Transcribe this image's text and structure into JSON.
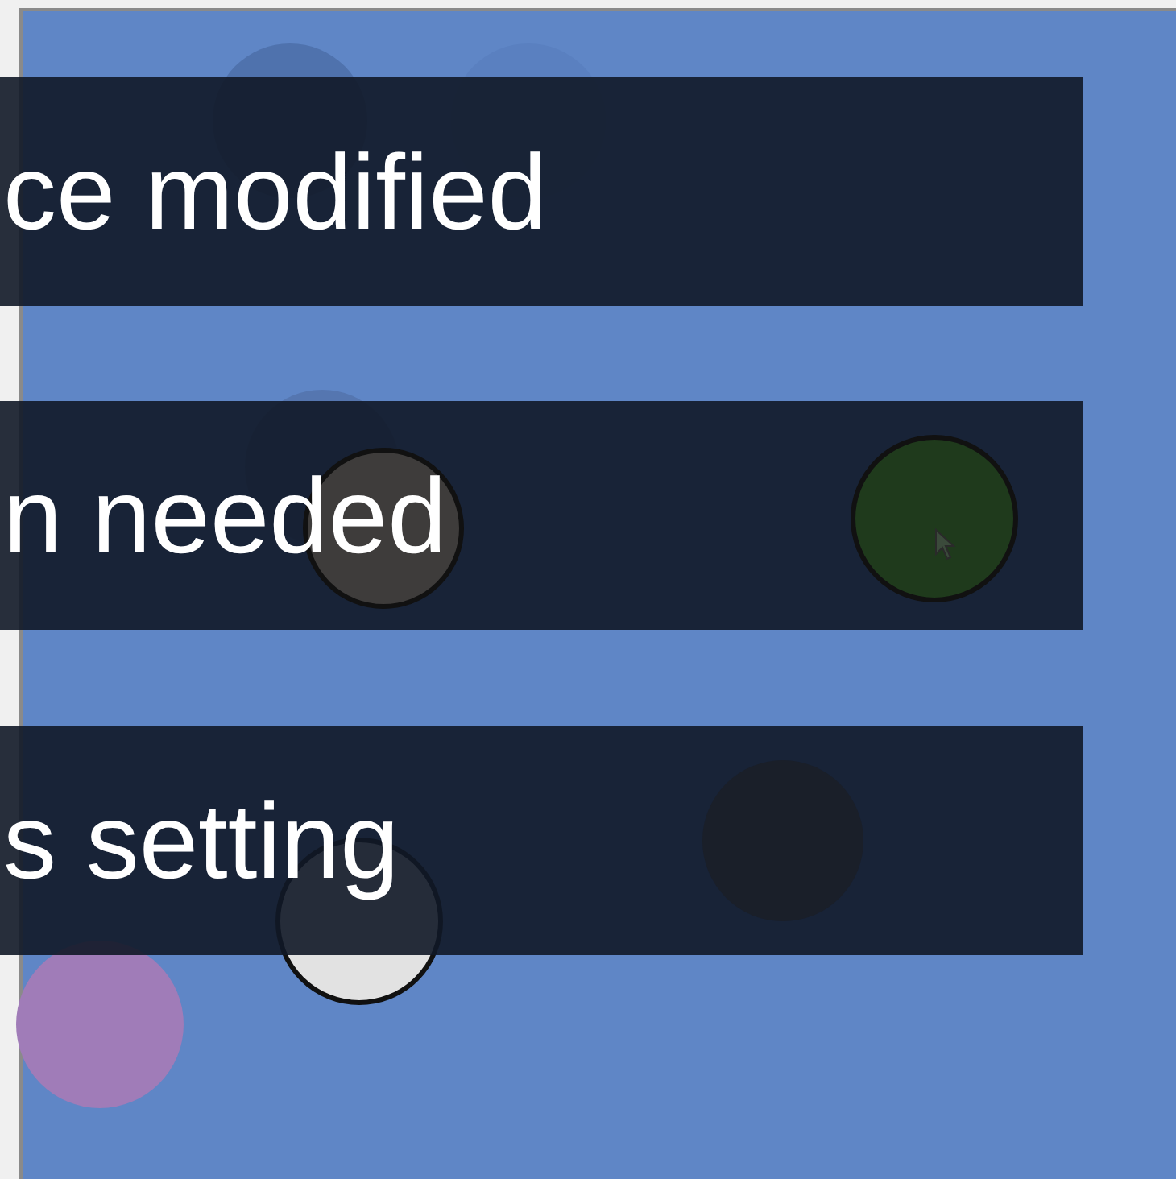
{
  "canvas": {
    "circles": [
      {
        "kind": "back",
        "color": "#4f72ad",
        "outlined": false
      },
      {
        "kind": "back",
        "color": "#5a80c0",
        "outlined": false
      },
      {
        "kind": "back",
        "color": "#5576b0",
        "outlined": false
      },
      {
        "kind": "front",
        "color": "#3e3c3b",
        "outlined": true
      },
      {
        "kind": "front",
        "color": "#1f3a1c",
        "outlined": true
      },
      {
        "kind": "front",
        "color": "#1a1f29",
        "outlined": false
      },
      {
        "kind": "back",
        "color": "#e2e2e2",
        "outlined": true
      },
      {
        "kind": "back",
        "color": "#a07cb8",
        "outlined": false
      }
    ]
  },
  "banners": [
    {
      "text": "ce modified"
    },
    {
      "text": "n needed"
    },
    {
      "text": "s setting"
    }
  ]
}
